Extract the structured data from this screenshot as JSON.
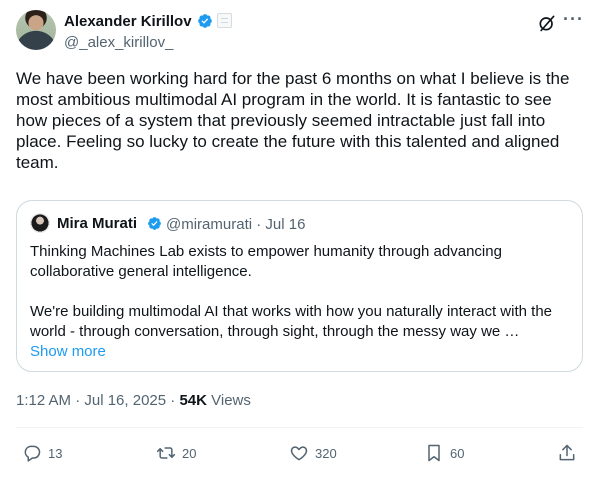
{
  "author": {
    "name": "Alexander Kirillov",
    "handle": "@_alex_kirillov_"
  },
  "tweet_text": "We have been working hard for the past 6 months on what I believe is the most ambitious multimodal AI program in the world. It is fantastic to see how pieces of a system that previously seemed intractable just fall into place. Feeling so lucky to create the future with this talented and aligned team.",
  "quoted": {
    "name": "Mira Murati",
    "handle_date": "@miramurati · Jul 16",
    "text_p1": "Thinking Machines Lab exists to empower humanity through advancing collaborative general intelligence.",
    "text_p2": "We're building multimodal AI that works with how you naturally interact with the world - through conversation, through sight, through the messy way we …",
    "show_more": "Show more"
  },
  "meta": {
    "time_date": "1:12 AM · Jul 16, 2025 · ",
    "views_count": "54K",
    "views_label": " Views"
  },
  "actions": {
    "replies": "13",
    "reposts": "20",
    "likes": "320",
    "bookmarks": "60"
  },
  "colors": {
    "accent": "#1d9bf0",
    "text": "#0f1419",
    "muted": "#536471",
    "border": "#cfd9de"
  },
  "icons": [
    "verified-badge-icon",
    "affiliation-badge-icon",
    "grok-icon",
    "more-icon",
    "reply-icon",
    "repost-icon",
    "like-icon",
    "bookmark-icon",
    "share-icon"
  ]
}
